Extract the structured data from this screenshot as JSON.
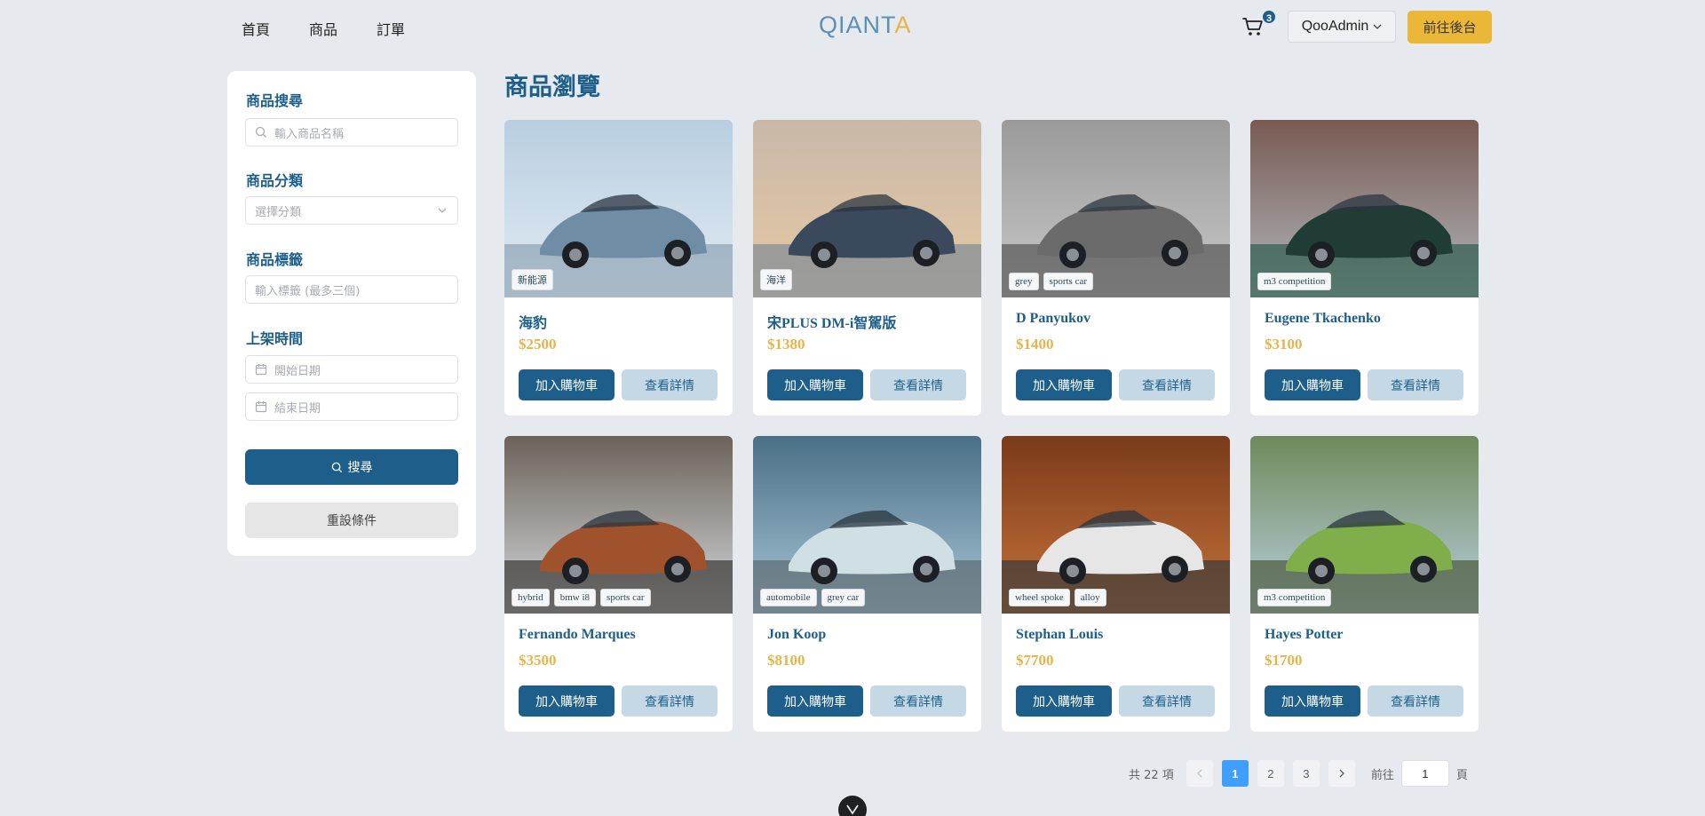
{
  "nav": {
    "home": "首頁",
    "products": "商品",
    "orders": "訂單"
  },
  "logo": {
    "part1": "QIANT",
    "part2": "A"
  },
  "cart": {
    "count": "3"
  },
  "user": {
    "name": "QooAdmin"
  },
  "admin_button": "前往後台",
  "sidebar": {
    "search_label": "商品搜尋",
    "search_placeholder": "輸入商品名稱",
    "category_label": "商品分類",
    "category_placeholder": "選擇分類",
    "tag_label": "商品標籤",
    "tag_placeholder": "輸入標籤 (最多三個)",
    "date_label": "上架時間",
    "start_placeholder": "開始日期",
    "end_placeholder": "結束日期",
    "search_button": "搜尋",
    "reset_button": "重設條件"
  },
  "page_title": "商品瀏覽",
  "buttons": {
    "add_to_cart": "加入購物車",
    "details": "查看詳情"
  },
  "products": [
    {
      "name": "海豹",
      "price": "$2500",
      "tags": [
        "新能源"
      ]
    },
    {
      "name": "宋PLUS DM-i智駕版",
      "price": "$1380",
      "tags": [
        "海洋"
      ]
    },
    {
      "name": "D Panyukov",
      "price": "$1400",
      "tags": [
        "grey",
        "sports car"
      ]
    },
    {
      "name": "Eugene Tkachenko",
      "price": "$3100",
      "tags": [
        "m3 competition"
      ]
    },
    {
      "name": "Fernando Marques",
      "price": "$3500",
      "tags": [
        "hybrid",
        "bmw i8",
        "sports car"
      ]
    },
    {
      "name": "Jon Koop",
      "price": "$8100",
      "tags": [
        "automobile",
        "grey car"
      ]
    },
    {
      "name": "Stephan Louis",
      "price": "$7700",
      "tags": [
        "wheel spoke",
        "alloy"
      ]
    },
    {
      "name": "Hayes Potter",
      "price": "$1700",
      "tags": [
        "m3 competition"
      ]
    }
  ],
  "pagination": {
    "total_text": "共 22 項",
    "pages": [
      "1",
      "2",
      "3"
    ],
    "current": "1",
    "goto_label": "前往",
    "goto_value": "1",
    "page_suffix": "頁"
  },
  "colors": {
    "primary": "#1d5f8a",
    "accent": "#e8b44a",
    "secondary": "#c4d8e6",
    "background": "#e6e9ee"
  },
  "icons": {
    "cart": "cart-icon",
    "chevron": "chevron-down-icon",
    "search": "search-icon",
    "calendar": "calendar-icon",
    "prev": "chevron-left-icon",
    "next": "chevron-right-icon"
  }
}
